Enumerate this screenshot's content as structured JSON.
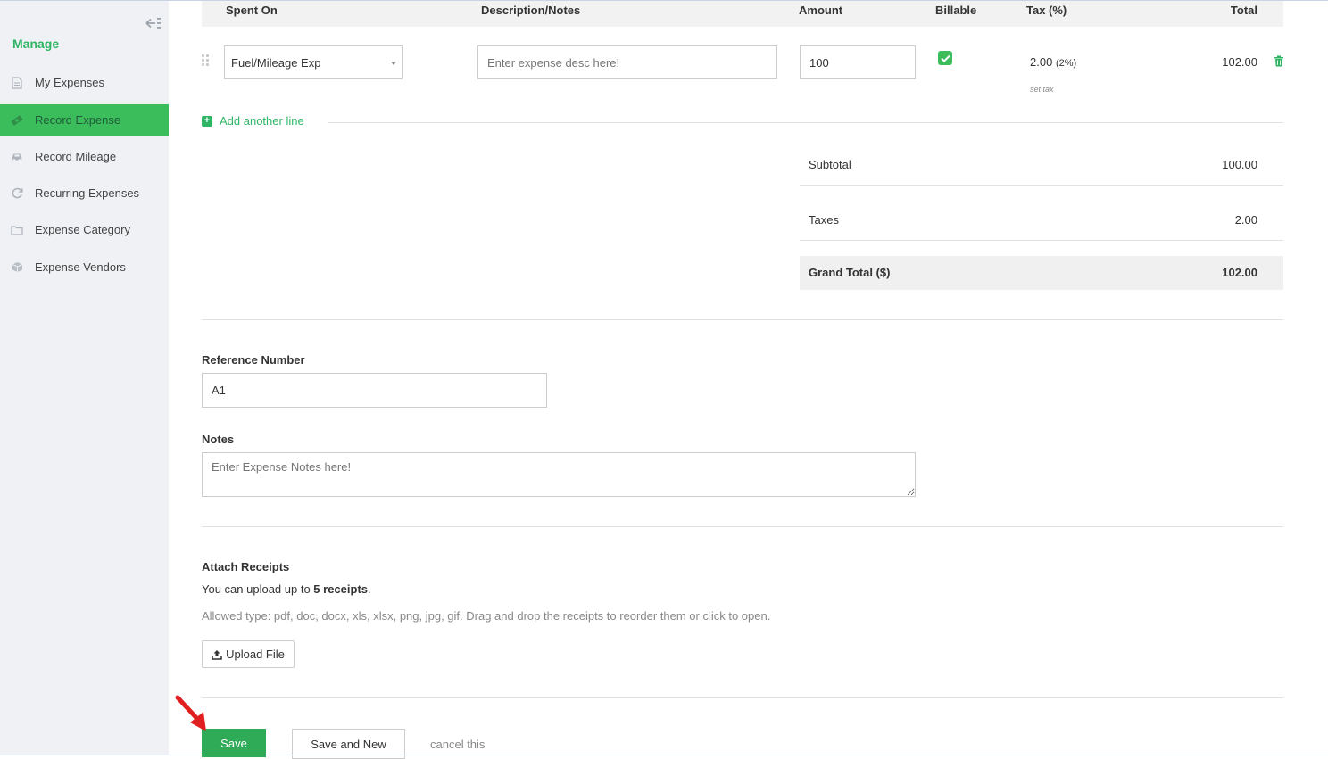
{
  "sidebar": {
    "title": "Manage",
    "items": [
      {
        "label": "My Expenses",
        "icon": "document-icon"
      },
      {
        "label": "Record Expense",
        "icon": "money-icon",
        "active": true
      },
      {
        "label": "Record Mileage",
        "icon": "car-icon"
      },
      {
        "label": "Recurring Expenses",
        "icon": "refresh-icon"
      },
      {
        "label": "Expense Category",
        "icon": "folder-icon"
      },
      {
        "label": "Expense Vendors",
        "icon": "box-icon"
      }
    ]
  },
  "table": {
    "headers": {
      "spent_on": "Spent On",
      "description": "Description/Notes",
      "amount": "Amount",
      "billable": "Billable",
      "tax": "Tax (%)",
      "total": "Total"
    },
    "row": {
      "spent_on": "Fuel/Mileage Exp",
      "description_placeholder": "Enter expense desc here!",
      "amount": "100",
      "billable": true,
      "tax_value": "2.00",
      "tax_pct": "(2%)",
      "set_tax": "set tax",
      "total": "102.00"
    },
    "add_line": "Add another line"
  },
  "totals": {
    "subtotal_label": "Subtotal",
    "subtotal_value": "100.00",
    "taxes_label": "Taxes",
    "taxes_value": "2.00",
    "grand_label": "Grand Total ($)",
    "grand_value": "102.00"
  },
  "form": {
    "reference_label": "Reference Number",
    "reference_value": "A1",
    "notes_label": "Notes",
    "notes_placeholder": "Enter Expense Notes here!"
  },
  "receipts": {
    "title": "Attach Receipts",
    "upload_prefix": "You can upload up to ",
    "upload_count": "5 receipts",
    "upload_suffix": ".",
    "allowed": "Allowed type: pdf, doc, docx, xls, xlsx, png, jpg, gif. Drag and drop the receipts to reorder them or click to open.",
    "upload_button": "Upload File"
  },
  "actions": {
    "save": "Save",
    "save_new": "Save and New",
    "cancel": "cancel this"
  },
  "colors": {
    "accent": "#3bbd5c",
    "accent_text": "#2db564",
    "save_button": "#2faa57",
    "annotation_arrow": "#e02020"
  }
}
